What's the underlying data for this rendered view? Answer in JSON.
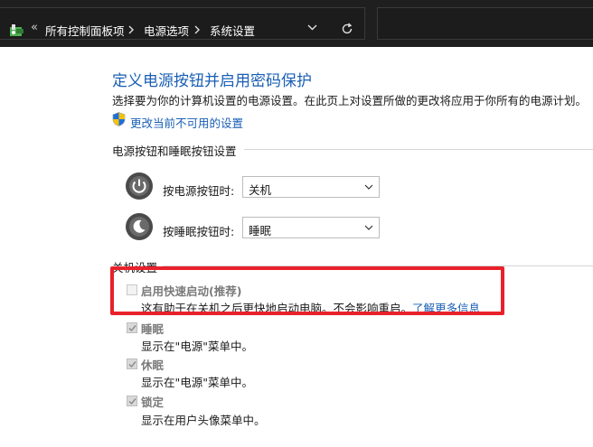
{
  "breadcrumb": {
    "back_glyph": "«",
    "items": [
      "所有控制面板项",
      "电源选项",
      "系统设置"
    ]
  },
  "page": {
    "title": "定义电源按钮并启用密码保护",
    "description": "选择要为你的计算机设置的电源设置。在此页上对设置所做的更改将应用于你所有的电源计划。",
    "change_link": "更改当前不可用的设置"
  },
  "buttons_group": {
    "label": "电源按钮和睡眠按钮设置",
    "power": {
      "label": "按电源按钮时:",
      "value": "关机"
    },
    "sleep": {
      "label": "按睡眠按钮时:",
      "value": "睡眠"
    }
  },
  "shutdown_group": {
    "label": "关机设置",
    "fast_startup": {
      "label": "启用快速启动(推荐)",
      "description": "这有助于在关机之后更快地启动电脑。不会影响重启。",
      "link": "了解更多信息",
      "checked": false
    },
    "sleep": {
      "label": "睡眠",
      "description": "显示在\"电源\"菜单中。",
      "checked": true
    },
    "hibernate": {
      "label": "休眠",
      "description": "显示在\"电源\"菜单中。",
      "checked": true
    },
    "lock": {
      "label": "锁定",
      "description": "显示在用户头像菜单中。",
      "checked": true
    }
  },
  "colors": {
    "link": "#1a5fb4",
    "highlight": "#e8212b",
    "address_bar": "#1f1f1f"
  }
}
